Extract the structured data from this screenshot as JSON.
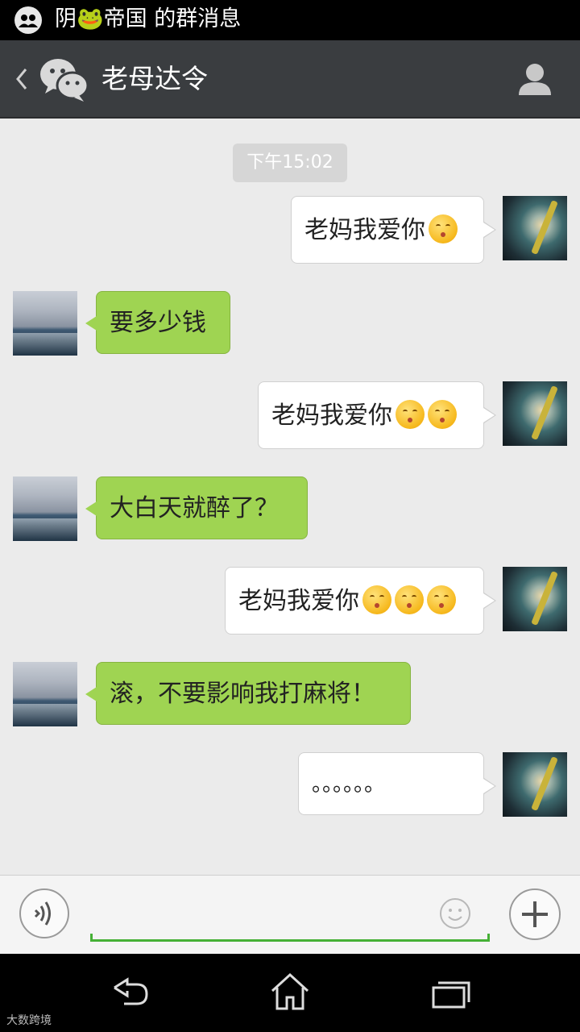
{
  "status_bar": {
    "title": "阴🐸帝国 的群消息"
  },
  "header": {
    "title": "老母达令"
  },
  "chat": {
    "timestamp": "下午15:02",
    "messages": [
      {
        "side": "right",
        "text": "老妈我爱你",
        "emoji_count": 1
      },
      {
        "side": "left",
        "text": "要多少钱"
      },
      {
        "side": "right",
        "text": "老妈我爱你",
        "emoji_count": 2
      },
      {
        "side": "left",
        "text": "大白天就醉了？"
      },
      {
        "side": "right",
        "text": "老妈我爱你",
        "emoji_count": 3
      },
      {
        "side": "left",
        "text": "滚，不要影响我打麻将！"
      },
      {
        "side": "right",
        "text": "。。。。。。"
      }
    ]
  },
  "input": {
    "value": "",
    "placeholder": ""
  },
  "watermark": {
    "text": "大数跨境"
  },
  "colors": {
    "sent_bubble": "#ffffff",
    "received_bubble": "#9fd452",
    "header_bg": "#3a3d40",
    "chat_bg": "#ebebeb",
    "input_underline": "#45b035"
  },
  "icons": [
    "group-chat-icon",
    "back-icon",
    "wechat-logo-icon",
    "person-icon",
    "voice-icon",
    "emoji-icon",
    "plus-icon",
    "nav-back-icon",
    "nav-home-icon",
    "nav-recent-icon",
    "kiss-emoji-icon"
  ]
}
